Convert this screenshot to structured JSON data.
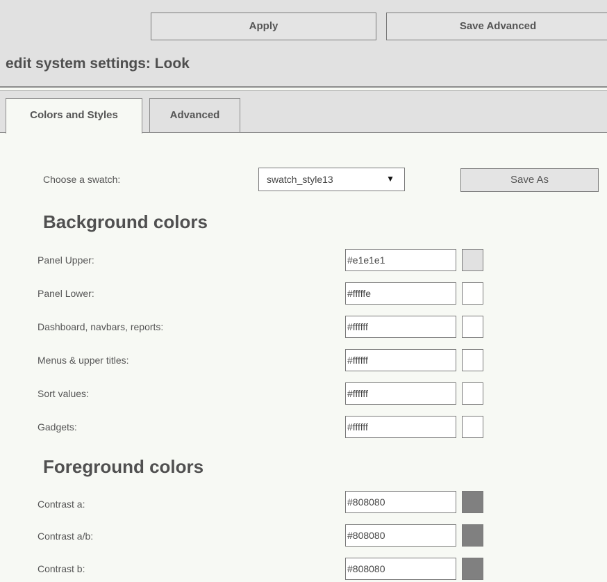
{
  "toolbar": {
    "apply_label": "Apply",
    "save_advanced_label": "Save Advanced"
  },
  "page_title": "edit system settings: Look",
  "tabs": [
    {
      "label": "Colors and Styles",
      "active": true
    },
    {
      "label": "Advanced",
      "active": false
    }
  ],
  "swatch": {
    "label": "Choose a swatch:",
    "selected": "swatch_style13",
    "save_as_label": "Save As"
  },
  "background_colors": {
    "heading": "Background colors",
    "rows": [
      {
        "label": "Panel Upper:",
        "value": "#e1e1e1",
        "swatch_color": "#e1e1e1"
      },
      {
        "label": "Panel Lower:",
        "value": "#fffffe",
        "swatch_color": "#fffffe"
      },
      {
        "label": "Dashboard, navbars, reports:",
        "value": "#ffffff",
        "swatch_color": "#ffffff"
      },
      {
        "label": "Menus & upper titles:",
        "value": "#ffffff",
        "swatch_color": "#ffffff"
      },
      {
        "label": "Sort values:",
        "value": "#ffffff",
        "swatch_color": "#ffffff"
      },
      {
        "label": "Gadgets:",
        "value": "#ffffff",
        "swatch_color": "#ffffff"
      }
    ]
  },
  "foreground_colors": {
    "heading": "Foreground colors",
    "rows": [
      {
        "label": "Contrast a:",
        "value": "#808080",
        "swatch_color": "#808080"
      },
      {
        "label": "Contrast a/b:",
        "value": "#808080",
        "swatch_color": "#808080"
      },
      {
        "label": "Contrast b:",
        "value": "#808080",
        "swatch_color": "#808080"
      }
    ]
  }
}
